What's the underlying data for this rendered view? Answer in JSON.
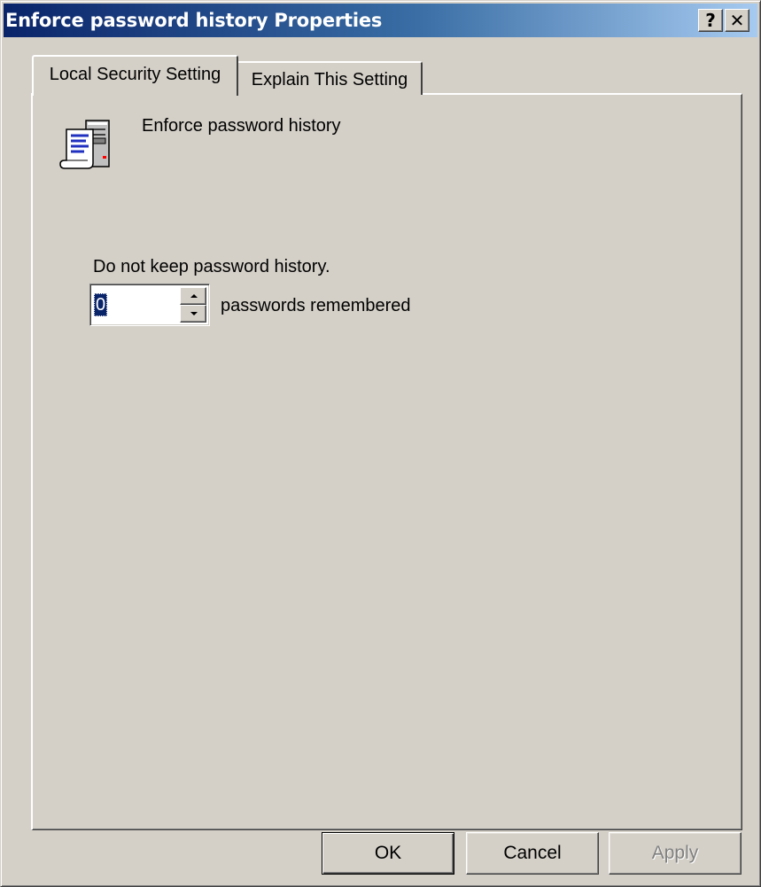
{
  "window": {
    "title": "Enforce password history Properties",
    "help_glyph": "?",
    "close_glyph": "✕"
  },
  "tabs": [
    {
      "label": "Local Security Setting",
      "active": true
    },
    {
      "label": "Explain This Setting",
      "active": false
    }
  ],
  "policy": {
    "icon": "security-policy-icon",
    "name": "Enforce password history"
  },
  "setting": {
    "description": "Do not keep password history.",
    "value": "0",
    "unit_label": "passwords remembered"
  },
  "buttons": {
    "ok": "OK",
    "cancel": "Cancel",
    "apply": "Apply"
  },
  "colors": {
    "title_gradient_start": "#0a246a",
    "title_gradient_end": "#a6caf0",
    "dialog_face": "#d4d0c8",
    "selection": "#0a246a"
  }
}
